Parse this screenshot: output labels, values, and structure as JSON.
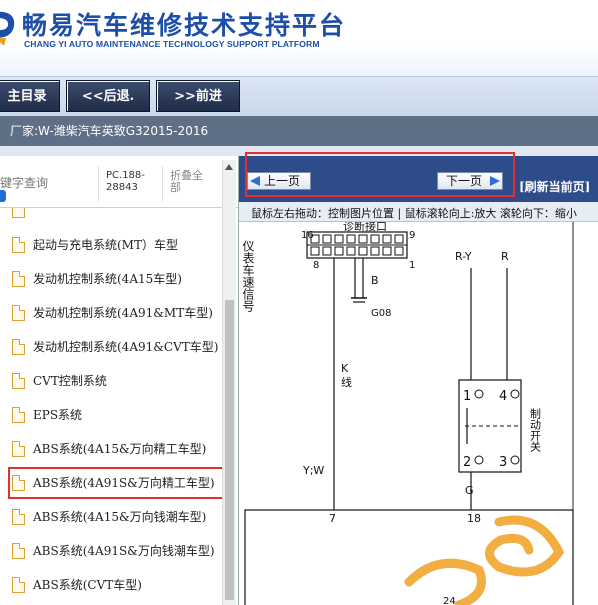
{
  "header": {
    "title_cn": "畅易汽车维修技术支持平台",
    "title_en": "CHANG YI AUTO MAINTENANCE TECHNOLOGY SUPPORT PLATFORM"
  },
  "nav": {
    "main_menu": "主目录",
    "back": "<<后退.",
    "forward": ">>前进"
  },
  "manufacturer": "厂家:W-潍柴汽车英致G32015-2016",
  "left_panel": {
    "keyword_search": "键字查询",
    "pc_code": "PC.188-28843",
    "fold_all": "折叠全部"
  },
  "tree_items": [
    {
      "label": "起动与充电系统(MT）车型"
    },
    {
      "label": "发动机控制系统(4A15车型)"
    },
    {
      "label": "发动机控制系统(4A91&MT车型)"
    },
    {
      "label": "发动机控制系统(4A91&CVT车型)"
    },
    {
      "label": "CVT控制系统"
    },
    {
      "label": "EPS系统"
    },
    {
      "label": "ABS系统(4A15&万向精工车型)"
    },
    {
      "label": "ABS系统(4A91S&万向精工车型)"
    },
    {
      "label": "ABS系统(4A15&万向钱潮车型)"
    },
    {
      "label": "ABS系统(4A91S&万向钱潮车型)"
    },
    {
      "label": "ABS系统(CVT车型)"
    }
  ],
  "pager": {
    "prev": "上一页",
    "next": "下一页",
    "refresh": "[刷新当前页]"
  },
  "hint": "鼠标左右拖动：控制图片位置 | 鼠标滚轮向上:放大   滚轮向下：缩小",
  "diagram": {
    "left_vertical_label": "仪表车速信号",
    "diag_port": "诊断接口",
    "pin_16": "16",
    "pin_9": "9",
    "pin_8": "8",
    "pin_1": "1",
    "wire_b": "B",
    "ground": "G08",
    "wire_k": "K",
    "wire_k2": "线",
    "wire_ry": "R-Y",
    "wire_r": "R",
    "switch_1": "1",
    "switch_4": "4",
    "switch_2": "2",
    "switch_3": "3",
    "brake_switch": "制动开关",
    "wire_yw": "Y;W",
    "wire_g": "G",
    "conn_7": "7",
    "conn_18": "18",
    "bottom_num": "24"
  },
  "colors": {
    "brand_blue": "#1d4fa8",
    "highlight_red": "#e03030",
    "pager_bar": "#2f4c8a"
  }
}
